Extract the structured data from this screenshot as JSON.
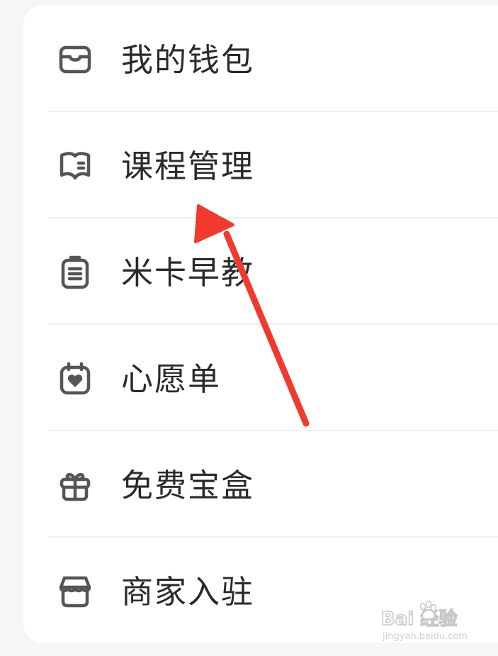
{
  "menu": {
    "items": [
      {
        "label": "我的钱包",
        "icon": "wallet-icon"
      },
      {
        "label": "课程管理",
        "icon": "course-book-icon"
      },
      {
        "label": "米卡早教",
        "icon": "clipboard-icon"
      },
      {
        "label": "心愿单",
        "icon": "calendar-heart-icon"
      },
      {
        "label": "免费宝盒",
        "icon": "gift-box-icon"
      },
      {
        "label": "商家入驻",
        "icon": "store-icon"
      }
    ]
  },
  "annotation": {
    "color": "#f03a2e",
    "icon": "red-arrow-icon"
  },
  "watermark": {
    "logo": "Bai 经验",
    "url": "jingyan.baidu.com"
  },
  "colors": {
    "background": "#f6f6f6",
    "card": "#ffffff",
    "text": "#2a2a2a",
    "icon": "#555555"
  }
}
